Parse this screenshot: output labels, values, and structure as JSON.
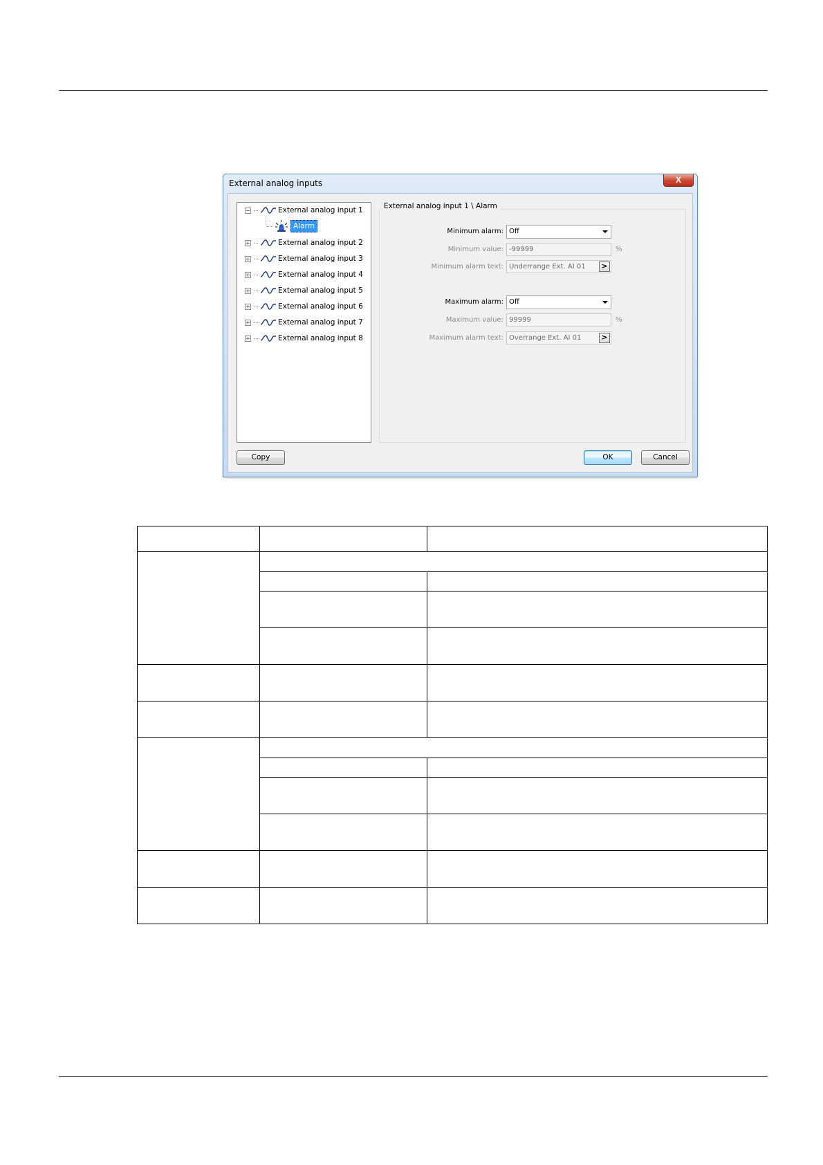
{
  "dialog": {
    "title": "External analog inputs",
    "close_label": "X",
    "tree": {
      "items": [
        {
          "label": "External analog input 1",
          "expander": "−"
        },
        {
          "label": "Alarm"
        },
        {
          "label": "External analog input 2",
          "expander": "+"
        },
        {
          "label": "External analog input 3",
          "expander": "+"
        },
        {
          "label": "External analog input 4",
          "expander": "+"
        },
        {
          "label": "External analog input 5",
          "expander": "+"
        },
        {
          "label": "External analog input 6",
          "expander": "+"
        },
        {
          "label": "External analog input 7",
          "expander": "+"
        },
        {
          "label": "External analog input 8",
          "expander": "+"
        }
      ]
    },
    "group_title": "External analog input 1 \\ Alarm",
    "min_alarm_label": "Minimum alarm:",
    "min_alarm_value": "Off",
    "min_value_label": "Minimum value:",
    "min_value": "-99999",
    "min_value_unit": "%",
    "min_text_label": "Minimum alarm text:",
    "min_text_value": "Underrange Ext. AI 01",
    "max_alarm_label": "Maximum alarm:",
    "max_alarm_value": "Off",
    "max_value_label": "Maximum value:",
    "max_value": "99999",
    "max_value_unit": "%",
    "max_text_label": "Maximum alarm text:",
    "max_text_value": "Overrange Ext. AI 01",
    "more_button_label": ">",
    "copy_button": "Copy",
    "ok_button": "OK",
    "cancel_button": "Cancel"
  }
}
